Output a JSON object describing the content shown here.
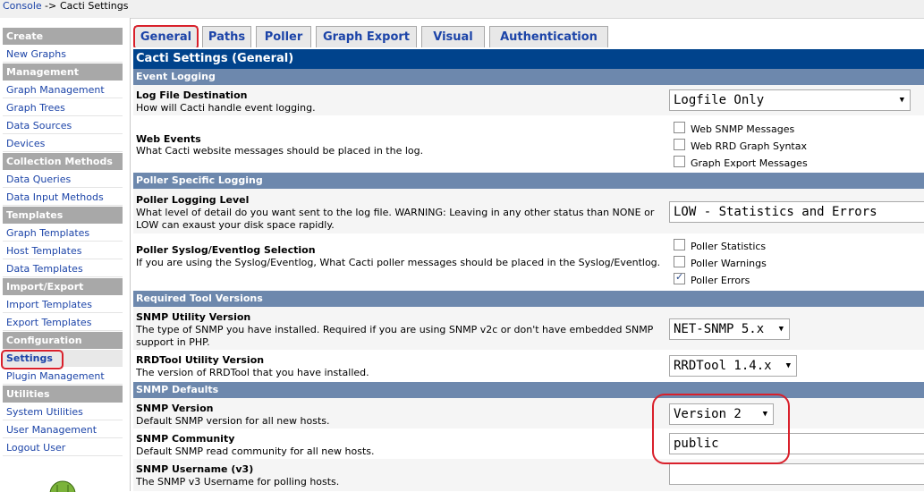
{
  "breadcrumb": {
    "root": "Console",
    "sep": "->",
    "current": "Cacti Settings"
  },
  "menu": {
    "sections": [
      {
        "header": "Create",
        "items": [
          "New Graphs"
        ]
      },
      {
        "header": "Management",
        "items": [
          "Graph Management",
          "Graph Trees",
          "Data Sources",
          "Devices"
        ]
      },
      {
        "header": "Collection Methods",
        "items": [
          "Data Queries",
          "Data Input Methods"
        ]
      },
      {
        "header": "Templates",
        "items": [
          "Graph Templates",
          "Host Templates",
          "Data Templates"
        ]
      },
      {
        "header": "Import/Export",
        "items": [
          "Import Templates",
          "Export Templates"
        ]
      },
      {
        "header": "Configuration",
        "items": [
          "Settings",
          "Plugin Management"
        ]
      },
      {
        "header": "Utilities",
        "items": [
          "System Utilities",
          "User Management",
          "Logout User"
        ]
      }
    ]
  },
  "tabs": [
    "General",
    "Paths",
    "Poller",
    "Graph Export",
    "Visual",
    "Authentication"
  ],
  "title": "Cacti Settings (General)",
  "sections": {
    "event_logging": "Event Logging",
    "poller_logging": "Poller Specific Logging",
    "tool_versions": "Required Tool Versions",
    "snmp_defaults": "SNMP Defaults"
  },
  "settings": {
    "log_dest": {
      "name": "Log File Destination",
      "desc": "How will Cacti handle event logging.",
      "value": "Logfile Only"
    },
    "web_events": {
      "name": "Web Events",
      "desc": "What Cacti website messages should be placed in the log.",
      "options": [
        "Web SNMP Messages",
        "Web RRD Graph Syntax",
        "Graph Export Messages"
      ]
    },
    "poller_level": {
      "name": "Poller Logging Level",
      "desc": "What level of detail do you want sent to the log file. WARNING: Leaving in any other status than NONE or LOW can exaust your disk space rapidly.",
      "value": "LOW - Statistics and Errors"
    },
    "poller_syslog": {
      "name": "Poller Syslog/Eventlog Selection",
      "desc": "If you are using the Syslog/Eventlog, What Cacti poller messages should be placed in the Syslog/Eventlog.",
      "options": [
        "Poller Statistics",
        "Poller Warnings",
        "Poller Errors"
      ]
    },
    "snmp_util": {
      "name": "SNMP Utility Version",
      "desc": "The type of SNMP you have installed. Required if you are using SNMP v2c or don't have embedded SNMP support in PHP.",
      "value": "NET-SNMP 5.x"
    },
    "rrdtool": {
      "name": "RRDTool Utility Version",
      "desc": "The version of RRDTool that you have installed.",
      "value": "RRDTool 1.4.x"
    },
    "snmp_ver": {
      "name": "SNMP Version",
      "desc": "Default SNMP version for all new hosts.",
      "value": "Version 2"
    },
    "snmp_comm": {
      "name": "SNMP Community",
      "desc": "Default SNMP read community for all new hosts.",
      "value": "public"
    },
    "snmp_user": {
      "name": "SNMP Username (v3)",
      "desc": "The SNMP v3 Username for polling hosts.",
      "value": ""
    }
  }
}
